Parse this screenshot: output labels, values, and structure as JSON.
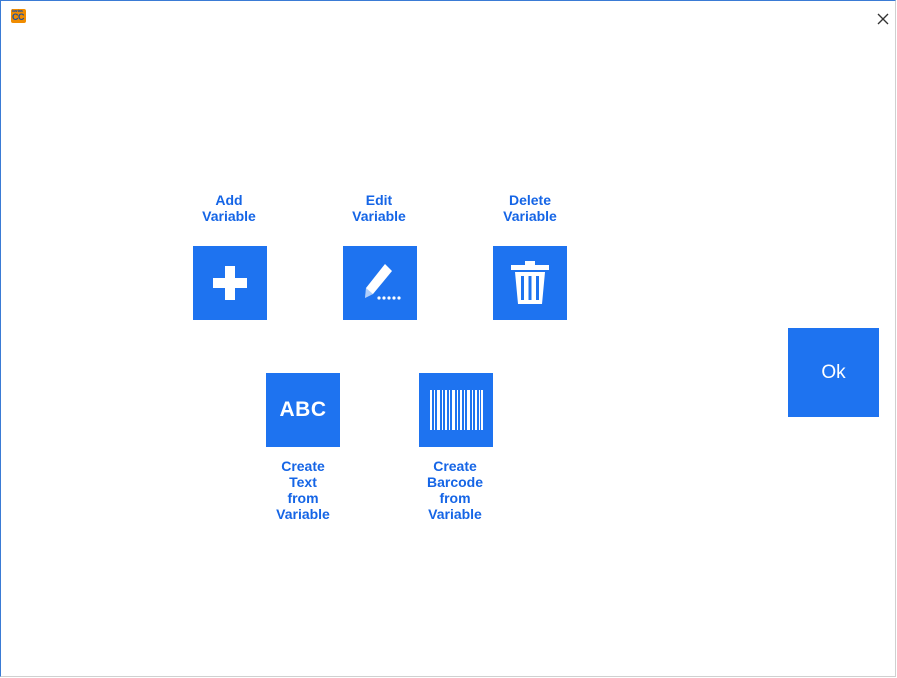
{
  "app": {
    "logo_small": "bartas",
    "logo_text": "CC"
  },
  "actions": {
    "add_variable": "Add\nVariable",
    "edit_variable": "Edit\nVariable",
    "delete_variable": "Delete\nVariable",
    "create_text": "Create\nText\nfrom\nVariable",
    "create_barcode": "Create\nBarcode\nfrom\nVariable",
    "abc_icon_text": "ABC"
  },
  "ok_label": "Ok",
  "colors": {
    "accent": "#1e73f0",
    "label": "#1565e6",
    "logo_bg": "#f08c00"
  },
  "icons": {
    "close": "close-icon",
    "add": "plus-icon",
    "edit": "pencil-icon",
    "delete": "trash-icon",
    "text": "abc-text-icon",
    "barcode": "barcode-icon"
  }
}
